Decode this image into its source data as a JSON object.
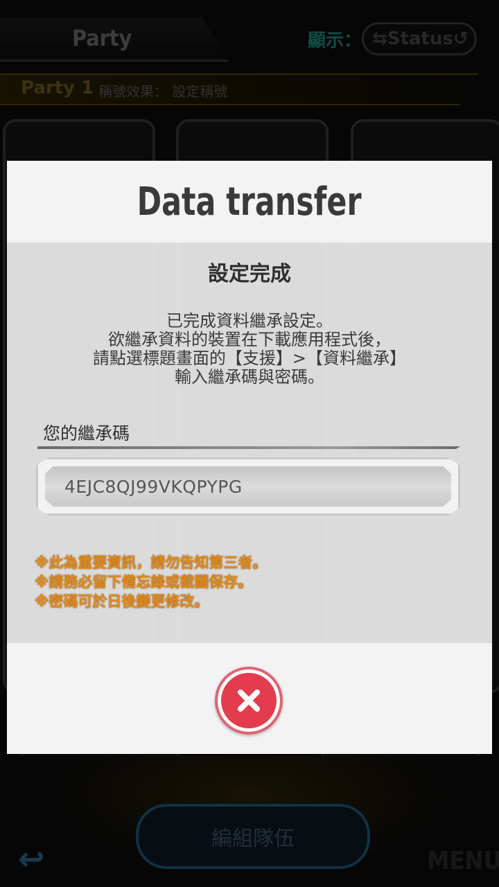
{
  "background": {
    "tab_title": "Party",
    "display_label": "顯示：",
    "status_toggle_label": "Status",
    "party_name": "Party 1",
    "party_effect": "稱號效果： 設定稱號",
    "form_team_button": "編組隊伍",
    "menu_button": "MENU"
  },
  "dialog": {
    "title": "Data transfer",
    "subtitle": "設定完成",
    "message_lines": [
      "已完成資料繼承設定。",
      "欲繼承資料的裝置在下載應用程式後，",
      "請點選標題畫面的【支援】>【資料繼承】",
      "輸入繼承碼與密碼。"
    ],
    "code_label": "您的繼承碼",
    "code_value": "4EJC8QJ99VKQPYPG",
    "warnings": [
      "※此為重要資訊，請勿告知第三者。",
      "※請務必留下備忘錄或截圖保存。",
      "※密碼可於日後變更修改。"
    ]
  },
  "colors": {
    "warning_text": "#e08a1e",
    "close_button": "#e23c4e",
    "header_bg": "#f3f3f3"
  },
  "icons": {
    "close": "close-icon",
    "back": "back-arrow-icon",
    "swap": "swap-arrows-icon"
  }
}
